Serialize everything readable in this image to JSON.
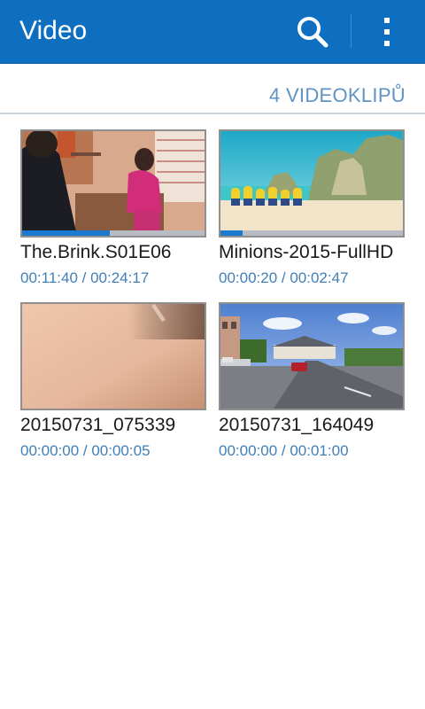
{
  "appbar": {
    "title": "Video",
    "search_icon": "search-icon",
    "more_icon": "more-vert-icon",
    "color": "#0e6fc1"
  },
  "list_header": {
    "count_label": "4 VIDEOKLIPŮ"
  },
  "videos": [
    {
      "name": "The.Brink.S01E06",
      "time": "00:11:40 / 00:24:17",
      "progress": 0.48
    },
    {
      "name": "Minions-2015-FullHD",
      "time": "00:00:20 / 00:02:47",
      "progress": 0.12
    },
    {
      "name": "20150731_075339",
      "time": "00:00:00 / 00:00:05",
      "progress": 0
    },
    {
      "name": "20150731_164049",
      "time": "00:00:00 / 00:01:00",
      "progress": 0
    }
  ]
}
